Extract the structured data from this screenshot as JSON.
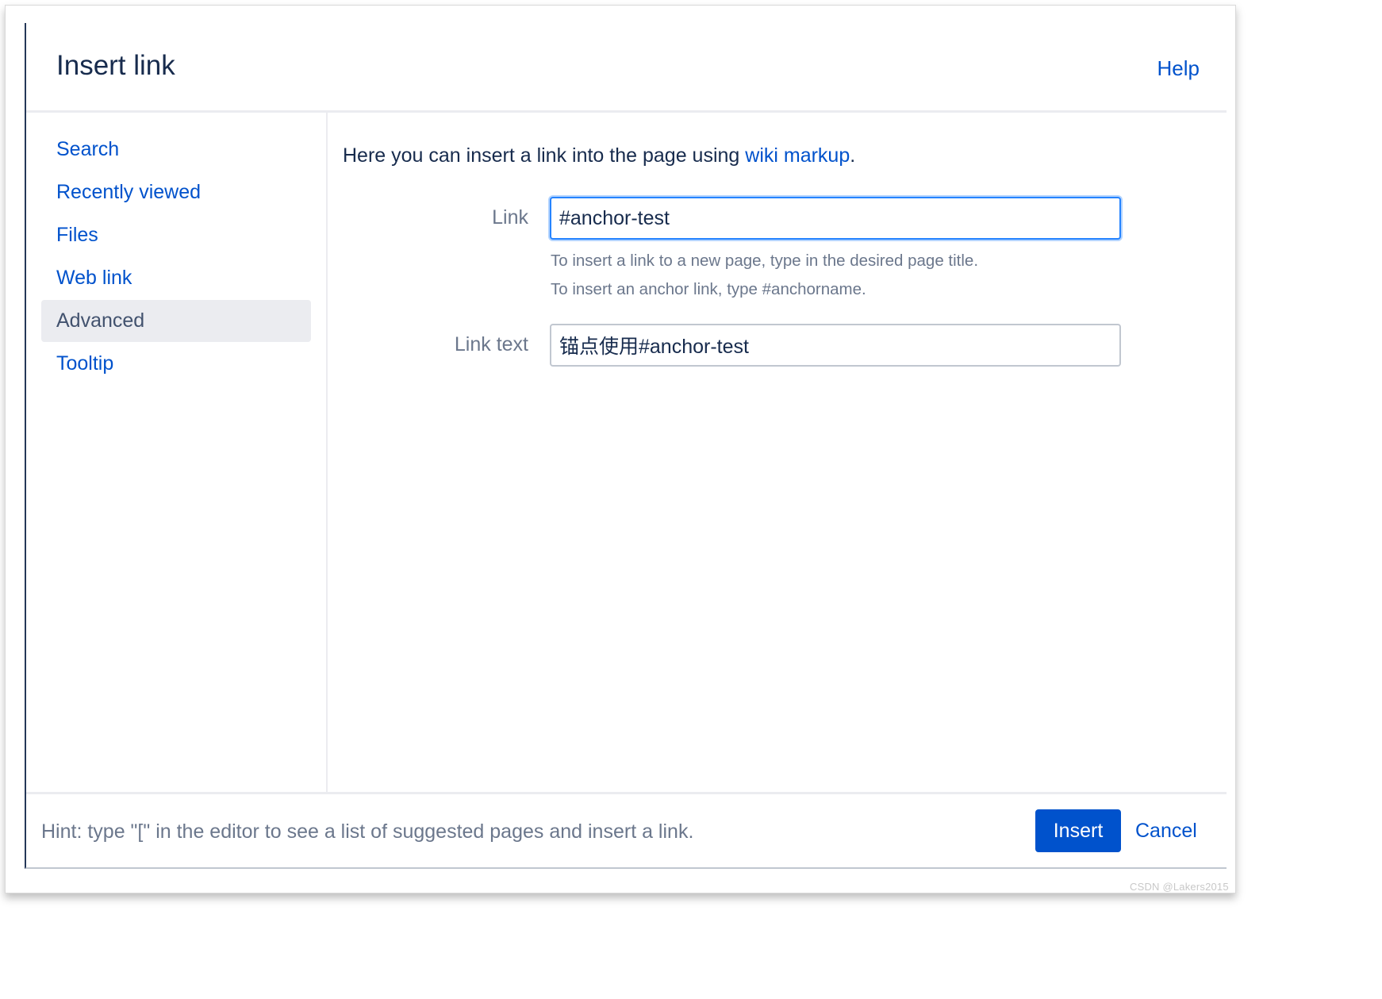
{
  "dialog": {
    "title": "Insert link",
    "help_label": "Help"
  },
  "sidebar": {
    "items": [
      {
        "label": "Search",
        "active": false
      },
      {
        "label": "Recently viewed",
        "active": false
      },
      {
        "label": "Files",
        "active": false
      },
      {
        "label": "Web link",
        "active": false
      },
      {
        "label": "Advanced",
        "active": true
      },
      {
        "label": "Tooltip",
        "active": false
      }
    ]
  },
  "content": {
    "intro_text": "Here you can insert a link into the page using ",
    "intro_link": "wiki markup",
    "intro_suffix": ".",
    "link_label": "Link",
    "link_value": "#anchor-test",
    "help_line_1": "To insert a link to a new page, type in the desired page title.",
    "help_line_2": "To insert an anchor link, type #anchorname.",
    "link_text_label": "Link text",
    "link_text_value": "锚点使用#anchor-test"
  },
  "footer": {
    "hint": "Hint: type \"[\" in the editor to see a list of suggested pages and insert a link.",
    "insert_label": "Insert",
    "cancel_label": "Cancel"
  },
  "watermark": "CSDN @Lakers2015",
  "colors": {
    "link": "#0052cc",
    "primary_button": "#0052cc",
    "focus_ring": "#2684ff",
    "active_nav_bg": "#ebecf0",
    "muted_text": "#6b778c"
  }
}
